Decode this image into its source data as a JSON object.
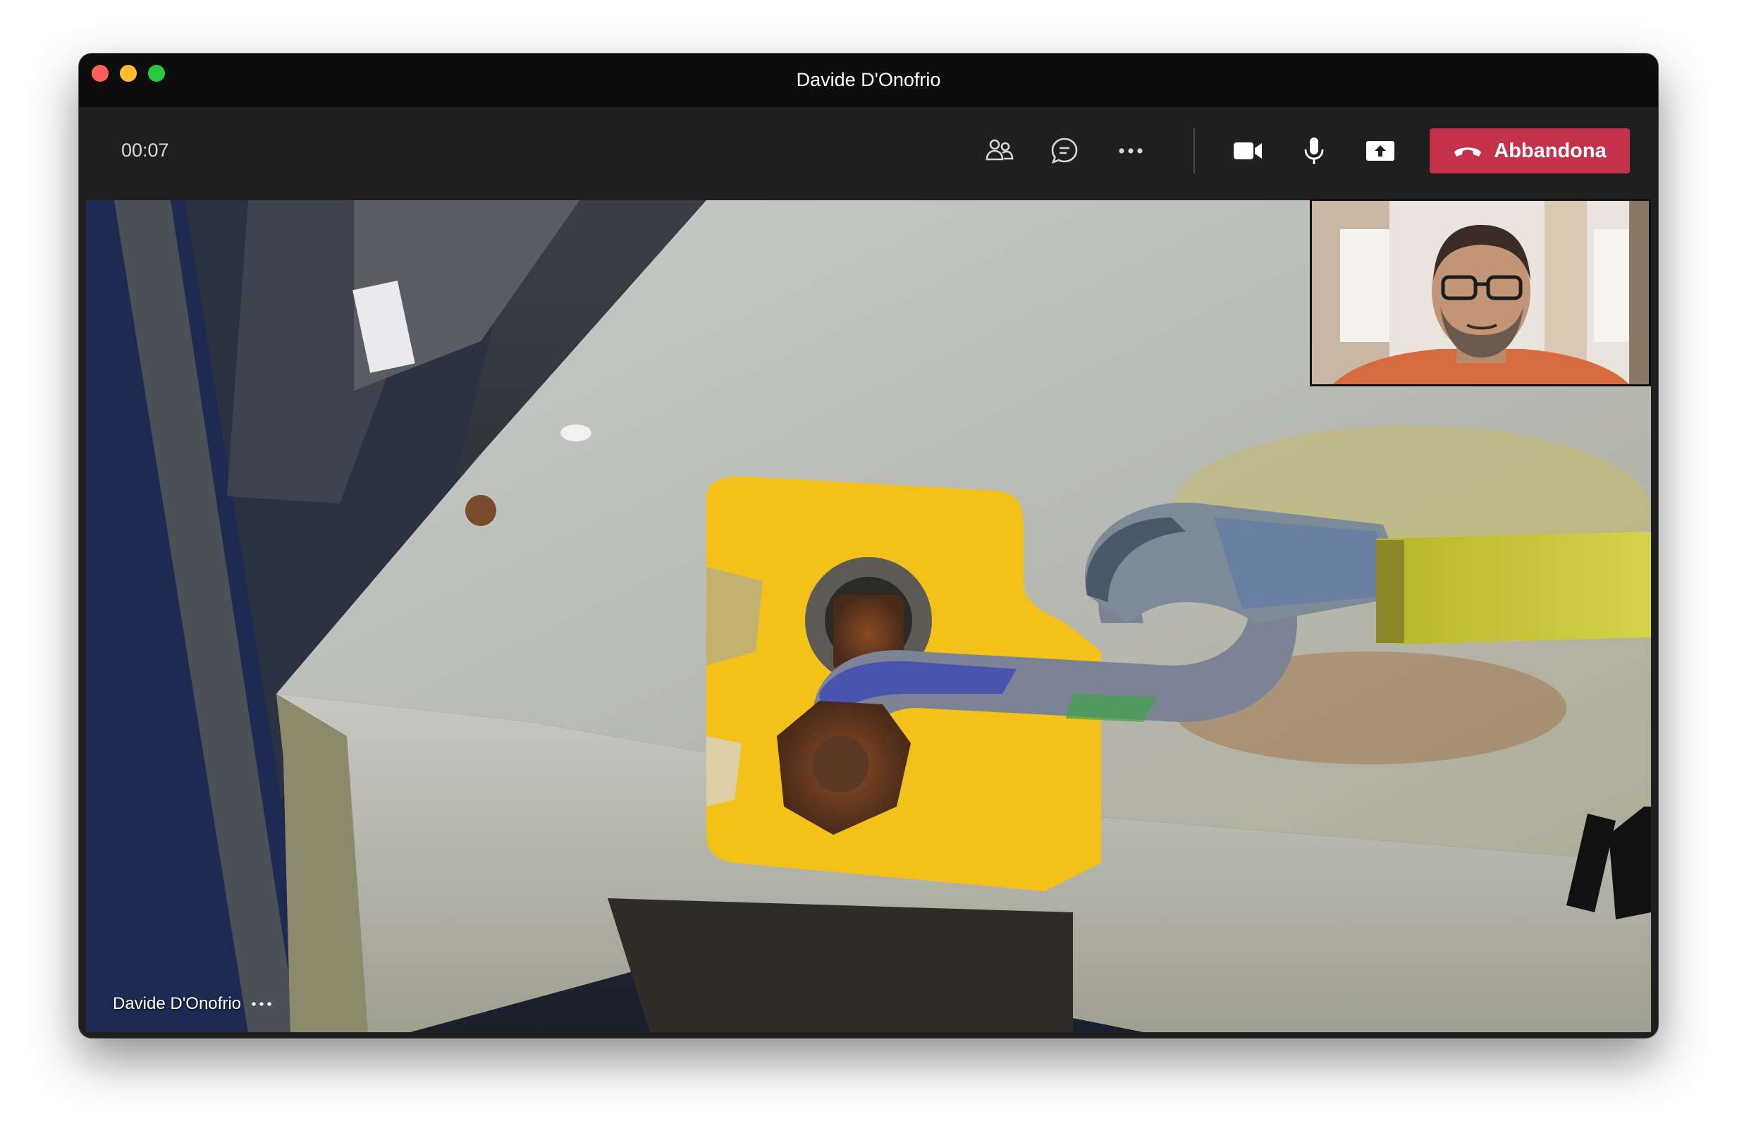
{
  "window": {
    "title": "Davide D'Onofrio"
  },
  "toolbar": {
    "timer": "00:07",
    "icons": {
      "participants": "people-icon",
      "chat": "chat-icon",
      "more": "more-dots-icon",
      "camera": "video-camera-icon",
      "mic": "microphone-icon",
      "share": "share-screen-icon"
    },
    "leave_label": "Abbandona",
    "leave_icon": "hang-up-icon"
  },
  "video": {
    "participant_name": "Davide D'Onofrio",
    "options_icon": "more-dots-icon"
  },
  "colors": {
    "leave_button": "#c4314b",
    "titlebar": "#0d0d0d",
    "toolbar": "#1f1f1f"
  }
}
